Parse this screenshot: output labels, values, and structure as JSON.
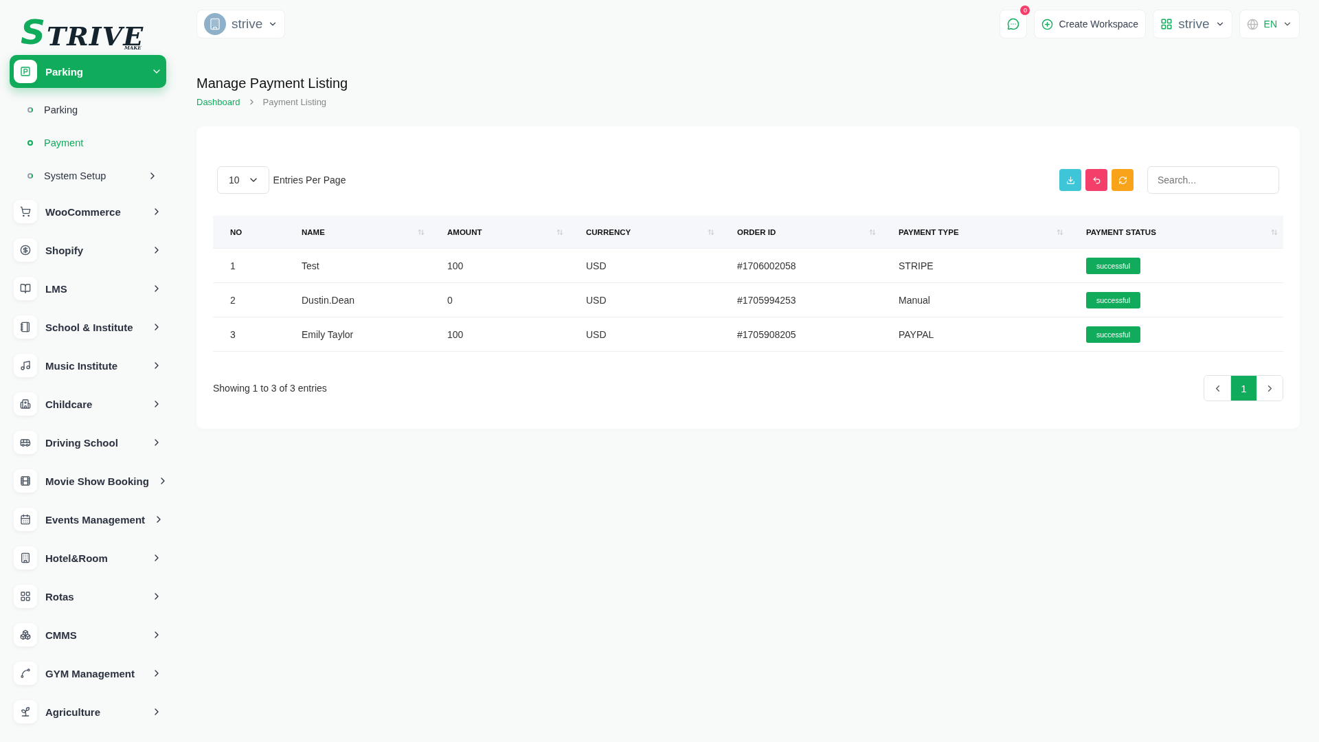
{
  "logo": {
    "initial": "S",
    "rest": "TRIVE",
    "tagline": "MAKE"
  },
  "sidebar": {
    "items": [
      {
        "label": "Parking",
        "selected": true,
        "expanded": true,
        "children": [
          {
            "label": "Parking",
            "selected": false,
            "has_arrow": false
          },
          {
            "label": "Payment",
            "selected": true,
            "has_arrow": false
          },
          {
            "label": "System Setup",
            "selected": false,
            "has_arrow": true
          }
        ]
      },
      {
        "label": "WooCommerce",
        "selected": false,
        "expanded": false
      },
      {
        "label": "Shopify",
        "selected": false,
        "expanded": false
      },
      {
        "label": "LMS",
        "selected": false,
        "expanded": false
      },
      {
        "label": "School & Institute",
        "selected": false,
        "expanded": false
      },
      {
        "label": "Music Institute",
        "selected": false,
        "expanded": false
      },
      {
        "label": "Childcare",
        "selected": false,
        "expanded": false
      },
      {
        "label": "Driving School",
        "selected": false,
        "expanded": false
      },
      {
        "label": "Movie Show Booking",
        "selected": false,
        "expanded": false
      },
      {
        "label": "Events Management",
        "selected": false,
        "expanded": false
      },
      {
        "label": "Hotel&Room",
        "selected": false,
        "expanded": false
      },
      {
        "label": "Rotas",
        "selected": false,
        "expanded": false
      },
      {
        "label": "CMMS",
        "selected": false,
        "expanded": false
      },
      {
        "label": "GYM Management",
        "selected": false,
        "expanded": false
      },
      {
        "label": "Agriculture",
        "selected": false,
        "expanded": false
      }
    ]
  },
  "header": {
    "workspace": "strive",
    "notifications": "0",
    "create_button": "Create Workspace",
    "project": "strive",
    "language": "EN"
  },
  "page": {
    "title": "Manage Payment Listing",
    "breadcrumb": [
      "Dashboard",
      "Payment Listing"
    ]
  },
  "table_controls": {
    "entries": "10",
    "entries_label": "Entries Per Page",
    "search_placeholder": "Search..."
  },
  "table": {
    "columns": [
      {
        "label": "NO",
        "sortable": false
      },
      {
        "label": "NAME",
        "sortable": true
      },
      {
        "label": "AMOUNT",
        "sortable": true
      },
      {
        "label": "CURRENCY",
        "sortable": true
      },
      {
        "label": "ORDER ID",
        "sortable": true
      },
      {
        "label": "PAYMENT TYPE",
        "sortable": true
      },
      {
        "label": "PAYMENT STATUS",
        "sortable": true
      }
    ],
    "rows": [
      {
        "no": "1",
        "name": "Test",
        "amount": "100",
        "currency": "USD",
        "order_id": "#1706002058",
        "payment_type": "STRIPE",
        "status": "successful"
      },
      {
        "no": "2",
        "name": "Dustin.Dean",
        "amount": "0",
        "currency": "USD",
        "order_id": "#1705994253",
        "payment_type": "Manual",
        "status": "successful"
      },
      {
        "no": "3",
        "name": "Emily Taylor",
        "amount": "100",
        "currency": "USD",
        "order_id": "#1705908205",
        "payment_type": "PAYPAL",
        "status": "successful"
      }
    ]
  },
  "footer": {
    "summary": "Showing 1 to 3 of 3 entries",
    "pages": [
      {
        "label": "1",
        "selected": true
      }
    ]
  }
}
